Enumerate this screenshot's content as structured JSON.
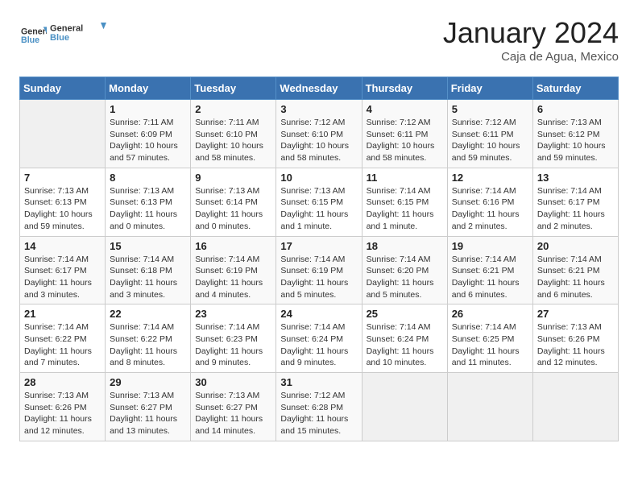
{
  "header": {
    "logo_line1": "General",
    "logo_line2": "Blue",
    "month": "January 2024",
    "location": "Caja de Agua, Mexico"
  },
  "weekdays": [
    "Sunday",
    "Monday",
    "Tuesday",
    "Wednesday",
    "Thursday",
    "Friday",
    "Saturday"
  ],
  "weeks": [
    [
      {
        "day": "",
        "info": ""
      },
      {
        "day": "1",
        "info": "Sunrise: 7:11 AM\nSunset: 6:09 PM\nDaylight: 10 hours and 57 minutes."
      },
      {
        "day": "2",
        "info": "Sunrise: 7:11 AM\nSunset: 6:10 PM\nDaylight: 10 hours and 58 minutes."
      },
      {
        "day": "3",
        "info": "Sunrise: 7:12 AM\nSunset: 6:10 PM\nDaylight: 10 hours and 58 minutes."
      },
      {
        "day": "4",
        "info": "Sunrise: 7:12 AM\nSunset: 6:11 PM\nDaylight: 10 hours and 58 minutes."
      },
      {
        "day": "5",
        "info": "Sunrise: 7:12 AM\nSunset: 6:11 PM\nDaylight: 10 hours and 59 minutes."
      },
      {
        "day": "6",
        "info": "Sunrise: 7:13 AM\nSunset: 6:12 PM\nDaylight: 10 hours and 59 minutes."
      }
    ],
    [
      {
        "day": "7",
        "info": "Sunrise: 7:13 AM\nSunset: 6:13 PM\nDaylight: 10 hours and 59 minutes."
      },
      {
        "day": "8",
        "info": "Sunrise: 7:13 AM\nSunset: 6:13 PM\nDaylight: 11 hours and 0 minutes."
      },
      {
        "day": "9",
        "info": "Sunrise: 7:13 AM\nSunset: 6:14 PM\nDaylight: 11 hours and 0 minutes."
      },
      {
        "day": "10",
        "info": "Sunrise: 7:13 AM\nSunset: 6:15 PM\nDaylight: 11 hours and 1 minute."
      },
      {
        "day": "11",
        "info": "Sunrise: 7:14 AM\nSunset: 6:15 PM\nDaylight: 11 hours and 1 minute."
      },
      {
        "day": "12",
        "info": "Sunrise: 7:14 AM\nSunset: 6:16 PM\nDaylight: 11 hours and 2 minutes."
      },
      {
        "day": "13",
        "info": "Sunrise: 7:14 AM\nSunset: 6:17 PM\nDaylight: 11 hours and 2 minutes."
      }
    ],
    [
      {
        "day": "14",
        "info": "Sunrise: 7:14 AM\nSunset: 6:17 PM\nDaylight: 11 hours and 3 minutes."
      },
      {
        "day": "15",
        "info": "Sunrise: 7:14 AM\nSunset: 6:18 PM\nDaylight: 11 hours and 3 minutes."
      },
      {
        "day": "16",
        "info": "Sunrise: 7:14 AM\nSunset: 6:19 PM\nDaylight: 11 hours and 4 minutes."
      },
      {
        "day": "17",
        "info": "Sunrise: 7:14 AM\nSunset: 6:19 PM\nDaylight: 11 hours and 5 minutes."
      },
      {
        "day": "18",
        "info": "Sunrise: 7:14 AM\nSunset: 6:20 PM\nDaylight: 11 hours and 5 minutes."
      },
      {
        "day": "19",
        "info": "Sunrise: 7:14 AM\nSunset: 6:21 PM\nDaylight: 11 hours and 6 minutes."
      },
      {
        "day": "20",
        "info": "Sunrise: 7:14 AM\nSunset: 6:21 PM\nDaylight: 11 hours and 6 minutes."
      }
    ],
    [
      {
        "day": "21",
        "info": "Sunrise: 7:14 AM\nSunset: 6:22 PM\nDaylight: 11 hours and 7 minutes."
      },
      {
        "day": "22",
        "info": "Sunrise: 7:14 AM\nSunset: 6:22 PM\nDaylight: 11 hours and 8 minutes."
      },
      {
        "day": "23",
        "info": "Sunrise: 7:14 AM\nSunset: 6:23 PM\nDaylight: 11 hours and 9 minutes."
      },
      {
        "day": "24",
        "info": "Sunrise: 7:14 AM\nSunset: 6:24 PM\nDaylight: 11 hours and 9 minutes."
      },
      {
        "day": "25",
        "info": "Sunrise: 7:14 AM\nSunset: 6:24 PM\nDaylight: 11 hours and 10 minutes."
      },
      {
        "day": "26",
        "info": "Sunrise: 7:14 AM\nSunset: 6:25 PM\nDaylight: 11 hours and 11 minutes."
      },
      {
        "day": "27",
        "info": "Sunrise: 7:13 AM\nSunset: 6:26 PM\nDaylight: 11 hours and 12 minutes."
      }
    ],
    [
      {
        "day": "28",
        "info": "Sunrise: 7:13 AM\nSunset: 6:26 PM\nDaylight: 11 hours and 12 minutes."
      },
      {
        "day": "29",
        "info": "Sunrise: 7:13 AM\nSunset: 6:27 PM\nDaylight: 11 hours and 13 minutes."
      },
      {
        "day": "30",
        "info": "Sunrise: 7:13 AM\nSunset: 6:27 PM\nDaylight: 11 hours and 14 minutes."
      },
      {
        "day": "31",
        "info": "Sunrise: 7:12 AM\nSunset: 6:28 PM\nDaylight: 11 hours and 15 minutes."
      },
      {
        "day": "",
        "info": ""
      },
      {
        "day": "",
        "info": ""
      },
      {
        "day": "",
        "info": ""
      }
    ]
  ]
}
